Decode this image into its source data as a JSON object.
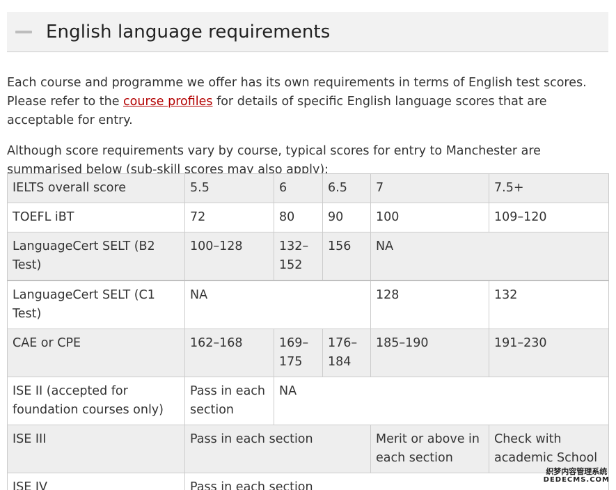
{
  "header": {
    "title": "English language requirements"
  },
  "intro": {
    "p1_before": "Each course and programme we offer has its own requirements in terms of English test scores. Please refer to the ",
    "p1_link": "course profiles",
    "p1_after": " for details of specific English language scores that are acceptable for entry.",
    "p2": "Although score requirements vary by course, typical scores for entry to Manchester are summarised below (sub-skill scores may also apply):"
  },
  "table": {
    "ielts": {
      "label": "IELTS overall score",
      "c1": "5.5",
      "c2": "6",
      "c3": "6.5",
      "c4": "7",
      "c5": "7.5+"
    },
    "toefl": {
      "label": "TOEFL iBT",
      "c1": "72",
      "c2": "80",
      "c3": "90",
      "c4": "100",
      "c5": "109–120"
    },
    "lc_b2": {
      "label": "LanguageCert SELT (B2 Test)",
      "c1": "100–128",
      "c2": "132–152",
      "c3": "156",
      "c4": "NA"
    },
    "lc_c1": {
      "label": "LanguageCert SELT (C1 Test)",
      "c1": "NA",
      "c2": "128",
      "c3": "132"
    },
    "cae": {
      "label": "CAE or CPE",
      "c1": "162–168",
      "c2": "169–175",
      "c3": "176–184",
      "c4": "185–190",
      "c5": "191–230"
    },
    "ise2": {
      "label": "ISE II (accepted for foundation courses only)",
      "c1": "Pass in each section",
      "c2": "NA"
    },
    "ise3": {
      "label": "ISE III",
      "c1": "Pass in each section",
      "c2": "Merit or above in each section",
      "c3": "Check with academic School"
    },
    "ise4": {
      "label": "ISE IV",
      "c1": "Pass in each section"
    }
  },
  "watermark": {
    "top": "织梦内容管理系统",
    "bottom": "DEDECMS.COM"
  }
}
